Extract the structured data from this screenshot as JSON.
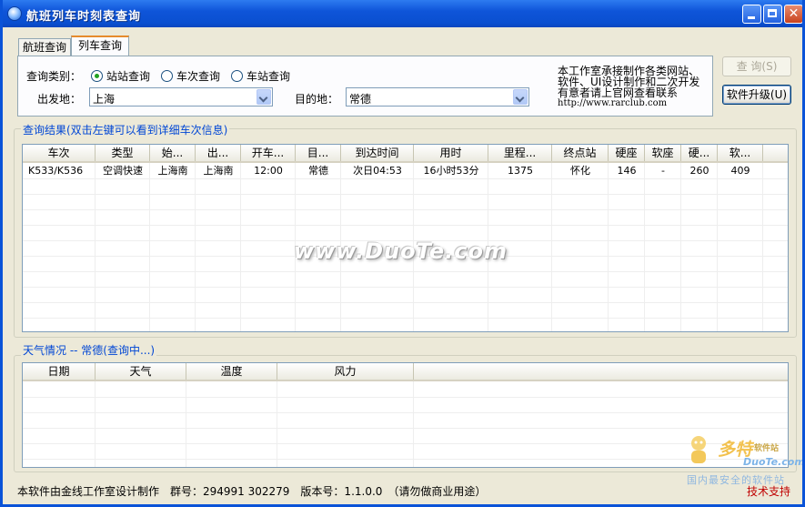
{
  "window": {
    "title": "航班列车时刻表查询"
  },
  "tabs": [
    {
      "label": "航班查询"
    },
    {
      "label": "列车查询"
    }
  ],
  "query": {
    "type_label": "查询类别：",
    "options": [
      {
        "label": "站站查询",
        "selected": true
      },
      {
        "label": "车次查询",
        "selected": false
      },
      {
        "label": "车站查询",
        "selected": false
      }
    ],
    "from_label": "出发地：",
    "from_value": "上海",
    "to_label": "目的地：",
    "to_value": "常德"
  },
  "info": {
    "line1": "本工作室承接制作各类网站、",
    "line2": "软件、UI设计制作和二次开发",
    "line3": "有意者请上官网查看联系",
    "url": "http://www.rarclub.com"
  },
  "buttons": {
    "query": "查 询(S)",
    "upgrade": "软件升级(U)"
  },
  "results": {
    "title": "查询结果(双击左键可以看到详细车次信息)",
    "columns": [
      "车次",
      "类型",
      "始...",
      "出...",
      "开车...",
      "目...",
      "到达时间",
      "用时",
      "里程...",
      "终点站",
      "硬座",
      "软座",
      "硬...",
      "软..."
    ],
    "rows": [
      [
        "K533/K536",
        "空调快速",
        "上海南",
        "上海南",
        "12:00",
        "常德",
        "次日04:53",
        "16小时53分",
        "1375",
        "怀化",
        "146",
        "-",
        "260",
        "409"
      ]
    ]
  },
  "weather": {
    "title": "天气情况 -- 常德(查询中...)",
    "columns": [
      "日期",
      "天气",
      "温度",
      "风力"
    ]
  },
  "watermarks": {
    "center": "www.DuoTe.com",
    "corner_big": "多特",
    "corner_small": "软件站",
    "corner_domain": "DuoTe.com",
    "corner_sub": "国内最安全的软件站"
  },
  "status": {
    "text": "本软件由金线工作室设计制作　群号：294991 302279　版本号：1.1.0.0　（请勿做商业用途）",
    "support": "技术支持"
  },
  "colors": {
    "titlebar": "#0A53D8",
    "group_title": "#0046D5",
    "support": "#C00000",
    "radio_dot": "#21A121"
  }
}
